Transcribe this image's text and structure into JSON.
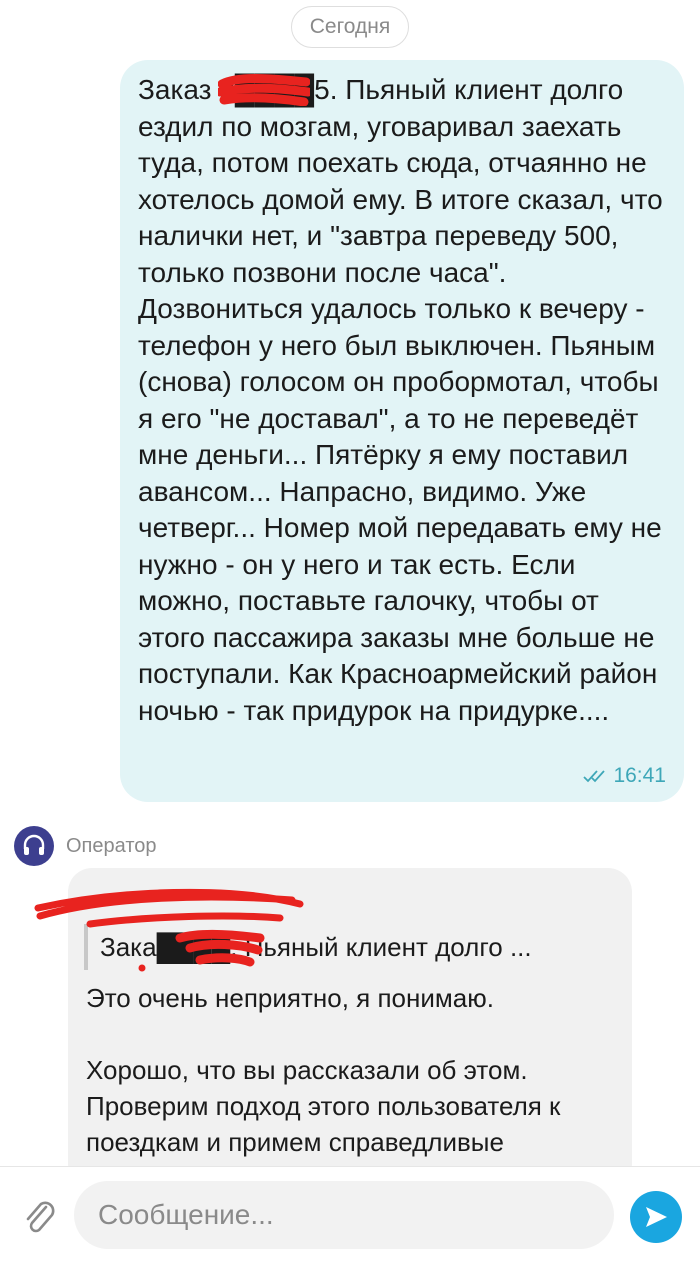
{
  "date_separator": "Сегодня",
  "outgoing": {
    "text": "Заказ 2████5. Пьяный клиент долго ездил по мозгам, уговаривал заехать туда, потом поехать сюда, отчаянно не хотелось домой ему. В итоге сказал, что налички нет, и \"завтра переведу 500, только позвони после часа\". Дозвониться удалось только к вечеру - телефон у него был выключен. Пьяным (снова) голосом он пробормотал, чтобы я его \"не доставал\", а то не переведёт мне деньги... Пятёрку я ему поставил авансом... Напрасно, видимо. Уже четверг...  Номер мой передавать ему не нужно - он у него и так есть. Если можно, поставьте галочку, чтобы от этого пассажира заказы мне больше не поступали. Как Красноармейский район ночью  - так придурок на придурке....",
    "time": "16:41",
    "status_icon": "double-check-icon"
  },
  "operator": {
    "name": "Оператор",
    "avatar_icon": "headphones-icon",
    "quote": "Зака████. Пьяный клиент долго ...",
    "text": "Это очень неприятно, я понимаю.\n\nХорошо, что вы рассказали об этом. Проверим подход этого пользователя к поездкам и примем справедливые"
  },
  "composer": {
    "placeholder": "Сообщение...",
    "attach_icon": "paperclip-icon",
    "send_icon": "send-icon"
  },
  "colors": {
    "outgoing_bubble": "#e2f4f6",
    "incoming_bubble": "#f1f1f1",
    "accent": "#1aa6e0",
    "avatar": "#3d3f8f",
    "redaction": "#e8231f"
  }
}
